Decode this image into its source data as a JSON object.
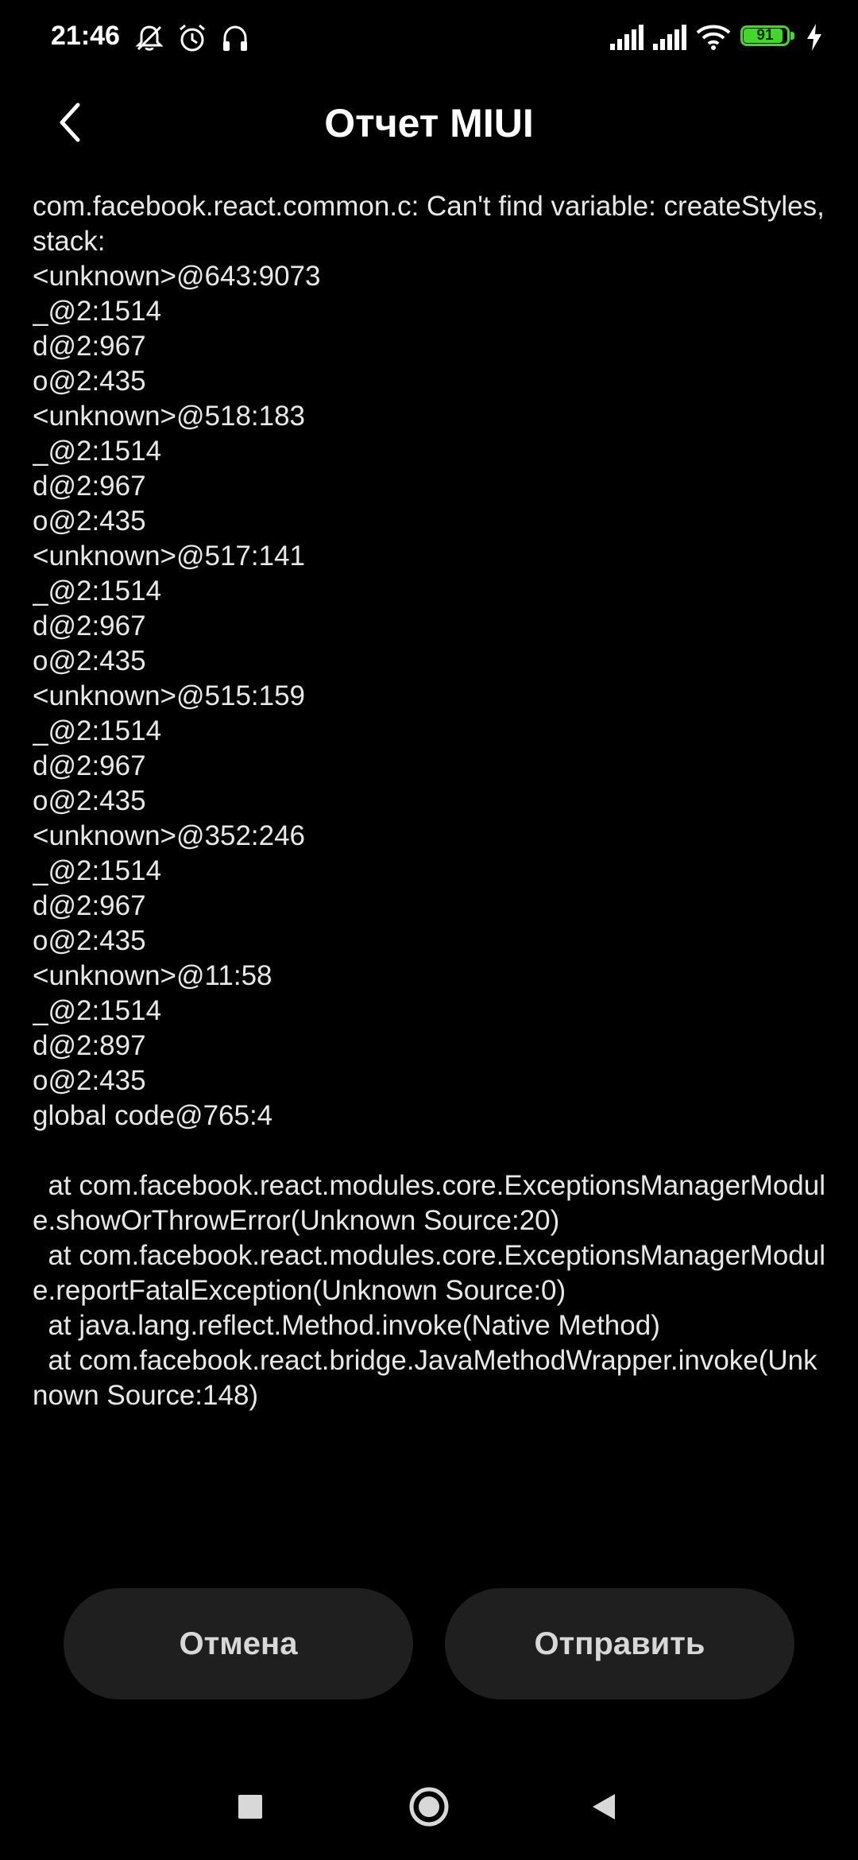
{
  "status_bar": {
    "time": "21:46",
    "left_icons": [
      "notifications-off-icon",
      "alarm-icon",
      "headphones-icon"
    ],
    "right_icons": [
      "cell-signal-icon",
      "cell-signal-icon",
      "wifi-icon",
      "battery-icon",
      "charging-icon"
    ],
    "battery_percent": "91",
    "battery_level": 0.91,
    "battery_color": "#44d62c"
  },
  "header": {
    "title": "Отчет MIUI",
    "back_icon": "chevron-left-icon"
  },
  "report": {
    "lines": [
      "com.facebook.react.common.c: Can't find variable: createStyles, stack:",
      "<unknown>@643:9073",
      "_@2:1514",
      "d@2:967",
      "o@2:435",
      "<unknown>@518:183",
      "_@2:1514",
      "d@2:967",
      "o@2:435",
      "<unknown>@517:141",
      "_@2:1514",
      "d@2:967",
      "o@2:435",
      "<unknown>@515:159",
      "_@2:1514",
      "d@2:967",
      "o@2:435",
      "<unknown>@352:246",
      "_@2:1514",
      "d@2:967",
      "o@2:435",
      "<unknown>@11:58",
      "_@2:1514",
      "d@2:897",
      "o@2:435",
      "global code@765:4",
      "",
      "  at com.facebook.react.modules.core.ExceptionsManagerModule.showOrThrowError(Unknown Source:20)",
      "  at com.facebook.react.modules.core.ExceptionsManagerModule.reportFatalException(Unknown Source:0)",
      "  at java.lang.reflect.Method.invoke(Native Method)",
      "  at com.facebook.react.bridge.JavaMethodWrapper.invoke(Unknown Source:148)"
    ]
  },
  "actions": {
    "cancel_label": "Отмена",
    "send_label": "Отправить"
  },
  "nav_bar": {
    "icons": [
      "recents-square-icon",
      "home-circle-icon",
      "back-triangle-icon"
    ]
  }
}
